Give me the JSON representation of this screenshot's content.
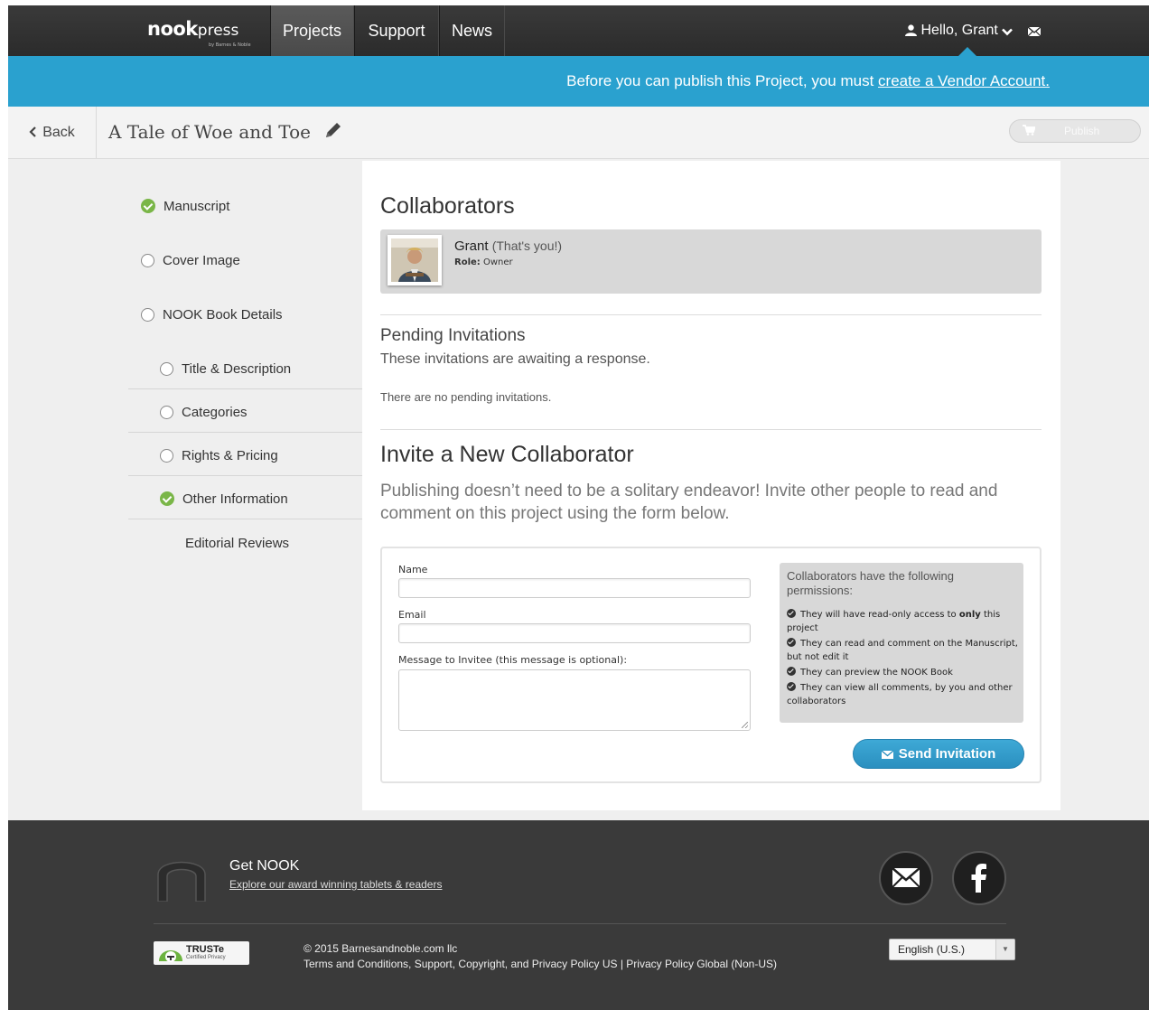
{
  "nav": {
    "logo_word": "nook",
    "logo_word2": "press",
    "logo_sub": "by Barnes & Noble",
    "tabs": [
      {
        "label": "Projects"
      },
      {
        "label": "Support"
      },
      {
        "label": "News"
      }
    ],
    "greeting": "Hello, Grant"
  },
  "banner": {
    "text": "Before you can publish this Project, you must ",
    "link": "create a Vendor Account."
  },
  "titlebar": {
    "back_label": "Back",
    "project_title": "A Tale of Woe and Toe",
    "publish_label": "Publish"
  },
  "sidebar": {
    "items": [
      {
        "label": "Manuscript",
        "status": "complete"
      },
      {
        "label": "Cover Image",
        "status": "incomplete"
      },
      {
        "label": "NOOK Book Details",
        "status": "incomplete"
      },
      {
        "label": "Title & Description",
        "status": "incomplete"
      },
      {
        "label": "Categories",
        "status": "incomplete"
      },
      {
        "label": "Rights & Pricing",
        "status": "incomplete"
      },
      {
        "label": "Other Information",
        "status": "complete"
      },
      {
        "label": "Editorial Reviews",
        "status": "none"
      }
    ]
  },
  "main": {
    "collaborators_heading": "Collaborators",
    "collaborator": {
      "name": "Grant",
      "note": "(That's you!)",
      "role_label": "Role:",
      "role_value": "Owner"
    },
    "pending_heading": "Pending Invitations",
    "pending_sub": "These invitations are awaiting a response.",
    "pending_empty": "There are no pending invitations.",
    "invite_heading": "Invite a New Collaborator",
    "invite_desc": "Publishing doesn’t need to be a solitary endeavor! Invite other people to read and comment on this project using the form below.",
    "form": {
      "name_label": "Name",
      "name_value": "",
      "email_label": "Email",
      "email_value": "",
      "message_label": "Message to Invitee (this message is optional):",
      "message_value": "",
      "send_label": "Send Invitation"
    },
    "permissions": {
      "title": "Collaborators have the following permissions:",
      "items": [
        {
          "pre": "They will have read-only access to ",
          "bold": "only",
          "post": " this project"
        },
        {
          "pre": "They can read and comment on the Manuscript, but not edit it",
          "bold": "",
          "post": ""
        },
        {
          "pre": "They can preview the NOOK Book",
          "bold": "",
          "post": ""
        },
        {
          "pre": "They can view all comments, by you and other collaborators",
          "bold": "",
          "post": ""
        }
      ]
    }
  },
  "footer": {
    "get_nook": "Get NOOK",
    "explore": "Explore our award winning tablets & readers",
    "truste_title": "TRUSTe",
    "truste_sub": "Certified Privacy",
    "copyright": "© 2015 Barnesandnoble.com llc",
    "links": "Terms and Conditions, Support, Copyright, and Privacy Policy US | Privacy Policy Global (Non-US)",
    "language": "English (U.S.)"
  },
  "colors": {
    "banner": "#2aa1cf",
    "check": "#7ab648",
    "send_button": "#2a8fbf"
  }
}
